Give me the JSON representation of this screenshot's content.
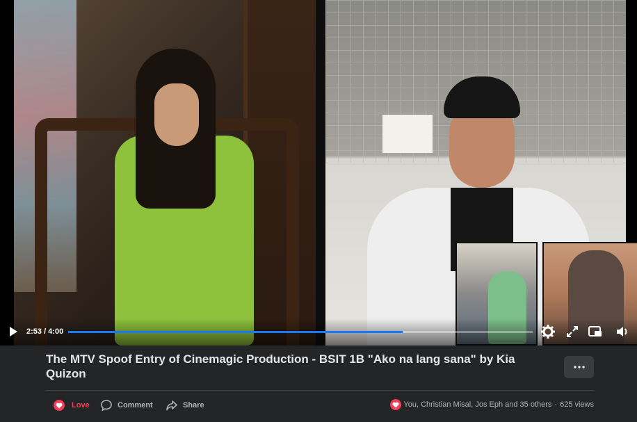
{
  "player": {
    "current_time": "2:53",
    "duration": "4:00",
    "time_display": "2:53 / 4:00",
    "progress_fraction": 0.72,
    "accent": "#1877f2",
    "controls": [
      "play-icon",
      "settings-gear-icon",
      "fullscreen-icon",
      "picture-in-picture-icon",
      "volume-icon"
    ]
  },
  "video": {
    "title": "The MTV Spoof Entry of Cinemagic Production - BSIT 1B \"Ako na lang sana\" by Kia Quizon"
  },
  "actions": {
    "love_label": "Love",
    "comment_label": "Comment",
    "share_label": "Share",
    "love_color": "#f33e58"
  },
  "stats": {
    "reactions_text": "You, Christian Misal, Jos Eph and 35 others",
    "separator": "·",
    "views": "625 views"
  }
}
